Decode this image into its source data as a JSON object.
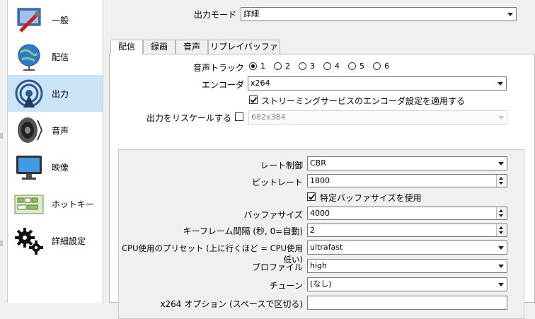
{
  "sidebar": {
    "items": [
      {
        "label": "一般",
        "icon": "wrench-icon"
      },
      {
        "label": "配信",
        "icon": "globe-icon"
      },
      {
        "label": "出力",
        "icon": "broadcast-icon",
        "selected": true
      },
      {
        "label": "音声",
        "icon": "speaker-icon"
      },
      {
        "label": "映像",
        "icon": "monitor-icon"
      },
      {
        "label": "ホットキー",
        "icon": "keyboard-icon"
      },
      {
        "label": "詳細設定",
        "icon": "gears-icon"
      }
    ]
  },
  "output_mode": {
    "label": "出力モード",
    "value": "詳細"
  },
  "tabs": [
    {
      "label": "配信",
      "active": true
    },
    {
      "label": "録画"
    },
    {
      "label": "音声"
    },
    {
      "label": "リプレイバッファー"
    }
  ],
  "audio_track": {
    "label": "音声トラック",
    "options": [
      "1",
      "2",
      "3",
      "4",
      "5",
      "6"
    ],
    "selected": "1"
  },
  "encoder": {
    "label": "エンコーダ",
    "value": "x264"
  },
  "apply_service_settings": {
    "label": "ストリーミングサービスのエンコーダ設定を適用する",
    "checked": true
  },
  "rescale": {
    "label": "出力をリスケールする",
    "checked": false,
    "value": "682x384"
  },
  "rate_control": {
    "label": "レート制御",
    "value": "CBR"
  },
  "bitrate": {
    "label": "ビットレート",
    "value": "1800"
  },
  "custom_buffer": {
    "label": "特定バッファサイズを使用",
    "checked": true
  },
  "buffer_size": {
    "label": "バッファサイズ",
    "value": "4000"
  },
  "keyframe": {
    "label": "キーフレーム間隔 (秒, 0=自動)",
    "value": "2"
  },
  "preset": {
    "label": "CPU使用のプリセット (上に行くほど = CPU使用低い)",
    "value": "ultrafast"
  },
  "profile": {
    "label": "プロファイル",
    "value": "high"
  },
  "tune": {
    "label": "チューン",
    "value": "(なし)"
  },
  "x264_options": {
    "label": "x264 オプション (スペースで区切る)",
    "value": ""
  }
}
